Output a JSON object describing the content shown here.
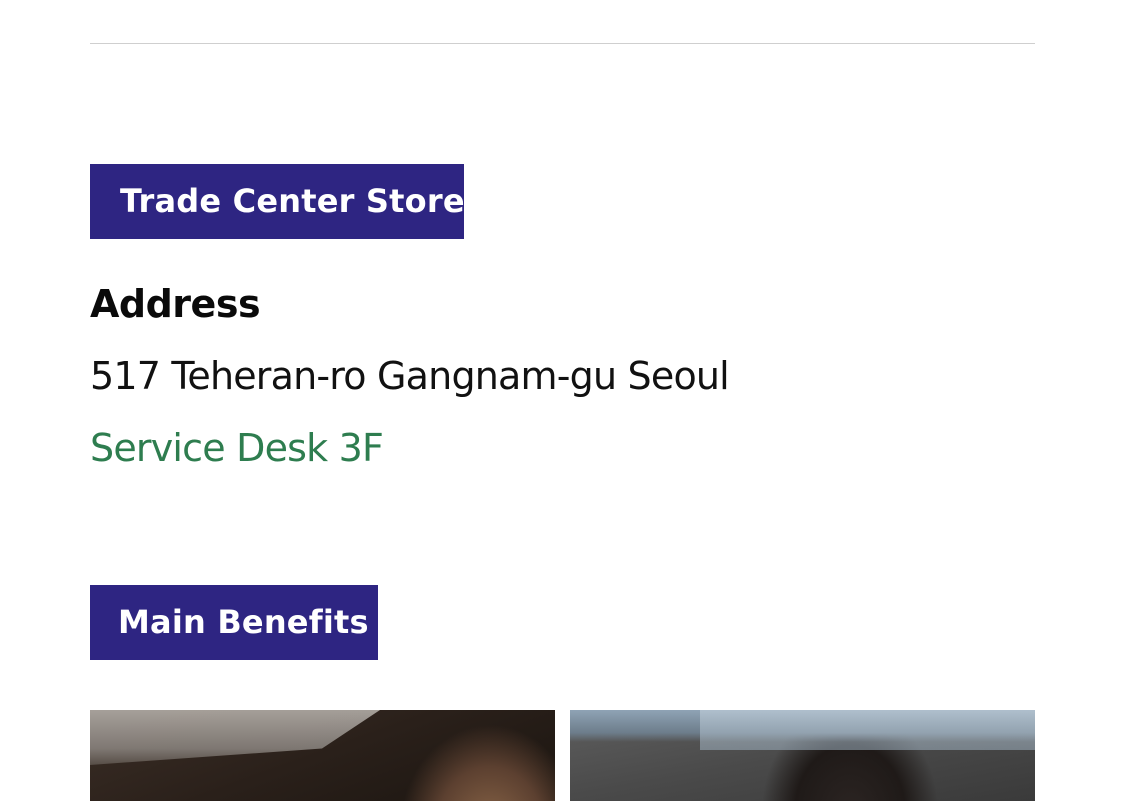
{
  "store_section": {
    "badge_label": "Trade Center Store",
    "address_heading": "Address",
    "address_line": "517 Teheran-ro Gangnam-gu Seoul",
    "desk_line": "Service Desk 3F"
  },
  "benefits_section": {
    "badge_label": "Main Benefits"
  },
  "colors": {
    "badge_background": "#2e2582",
    "desk_text": "#2e7d4f"
  }
}
